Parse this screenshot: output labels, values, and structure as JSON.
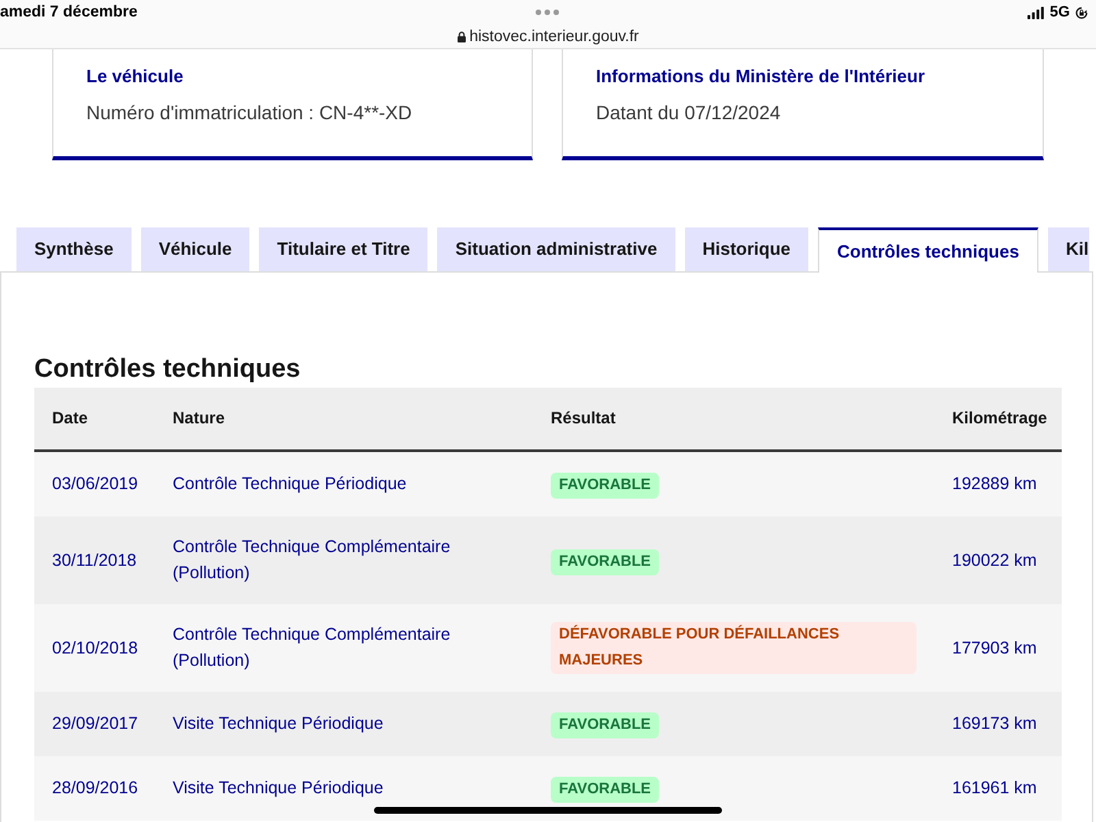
{
  "status_bar": {
    "date": "amedi 7 décembre",
    "url": "histovec.interieur.gouv.fr",
    "network": "5G"
  },
  "cards": [
    {
      "title": "Le véhicule",
      "text": "Numéro d'immatriculation : CN-4**-XD"
    },
    {
      "title": "Informations du Ministère de l'Intérieur",
      "text": "Datant du 07/12/2024"
    }
  ],
  "tabs": [
    {
      "label": "Synthèse",
      "selected": false
    },
    {
      "label": "Véhicule",
      "selected": false
    },
    {
      "label": "Titulaire et Titre",
      "selected": false
    },
    {
      "label": "Situation administrative",
      "selected": false
    },
    {
      "label": "Historique",
      "selected": false
    },
    {
      "label": "Contrôles techniques",
      "selected": true
    },
    {
      "label": "Kil",
      "selected": false
    }
  ],
  "section": {
    "title": "Contrôles techniques",
    "table": {
      "columns": [
        "Date",
        "Nature",
        "Résultat",
        "Kilométrage"
      ],
      "rows": [
        {
          "date": "03/06/2019",
          "nature": "Contrôle Technique Périodique",
          "result": {
            "kind": "success",
            "label": "FAVORABLE"
          },
          "mileage": "192889 km"
        },
        {
          "date": "30/11/2018",
          "nature": "Contrôle Technique Complémentaire (Pollution)",
          "result": {
            "kind": "success",
            "label": "FAVORABLE"
          },
          "mileage": "190022 km"
        },
        {
          "date": "02/10/2018",
          "nature": "Contrôle Technique Complémentaire (Pollution)",
          "result": {
            "kind": "error",
            "label": "DÉFAVORABLE POUR DÉFAILLANCES MAJEURES"
          },
          "mileage": "177903 km"
        },
        {
          "date": "29/09/2017",
          "nature": "Visite Technique Périodique",
          "result": {
            "kind": "success",
            "label": "FAVORABLE"
          },
          "mileage": "169173 km"
        },
        {
          "date": "28/09/2016",
          "nature": "Visite Technique Périodique",
          "result": {
            "kind": "success",
            "label": "FAVORABLE"
          },
          "mileage": "161961 km"
        }
      ]
    }
  }
}
